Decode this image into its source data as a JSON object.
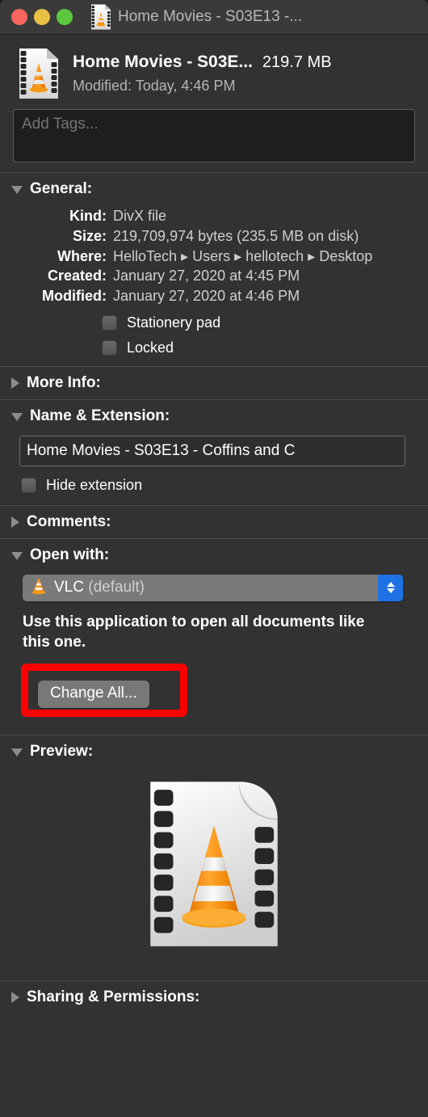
{
  "window": {
    "title": "Home Movies - S03E13 -...",
    "traffic_lights": [
      {
        "name": "close",
        "color": "#f9655f"
      },
      {
        "name": "minimize",
        "color": "#e7c044"
      },
      {
        "name": "zoom",
        "color": "#5bc840"
      }
    ],
    "title_icon": "vlc-movie-file-icon"
  },
  "header": {
    "icon": "vlc-movie-file-icon",
    "name": "Home Movies - S03E...",
    "size": "219.7 MB",
    "modified": "Modified: Today, 4:46 PM"
  },
  "tags": {
    "placeholder": "Add Tags..."
  },
  "sections": {
    "general": {
      "label": "General:",
      "expanded": true,
      "rows": [
        {
          "key": "Kind:",
          "value": "DivX file"
        },
        {
          "key": "Size:",
          "value": "219,709,974 bytes (235.5 MB on disk)"
        },
        {
          "key": "Where:",
          "value": "HelloTech ▸ Users ▸ hellotech ▸ Desktop",
          "path_parts": [
            "HelloTech",
            "Users",
            "hellotech",
            "Desktop"
          ]
        },
        {
          "key": "Created:",
          "value": "January 27, 2020 at 4:45 PM"
        },
        {
          "key": "Modified:",
          "value": "January 27, 2020 at 4:46 PM"
        }
      ],
      "checkboxes": [
        {
          "label": "Stationery pad",
          "checked": false
        },
        {
          "label": "Locked",
          "checked": false
        }
      ]
    },
    "more_info": {
      "label": "More Info:",
      "expanded": false
    },
    "name_extension": {
      "label": "Name & Extension:",
      "expanded": true,
      "filename_value": "Home Movies - S03E13 - Coffins and C",
      "hide_extension": {
        "label": "Hide extension",
        "checked": false
      }
    },
    "comments": {
      "label": "Comments:",
      "expanded": false
    },
    "open_with": {
      "label": "Open with:",
      "expanded": true,
      "app_icon": "vlc-cone-icon",
      "app_name": "VLC",
      "app_default_suffix": "(default)",
      "description": "Use this application to open all documents like this one.",
      "change_all_button": "Change All..."
    },
    "preview": {
      "label": "Preview:",
      "expanded": true,
      "icon": "vlc-movie-file-icon"
    },
    "sharing": {
      "label": "Sharing & Permissions:",
      "expanded": false
    }
  },
  "annotation": {
    "type": "highlight-rectangle",
    "color": "#ff0000",
    "target": "Change All..."
  }
}
